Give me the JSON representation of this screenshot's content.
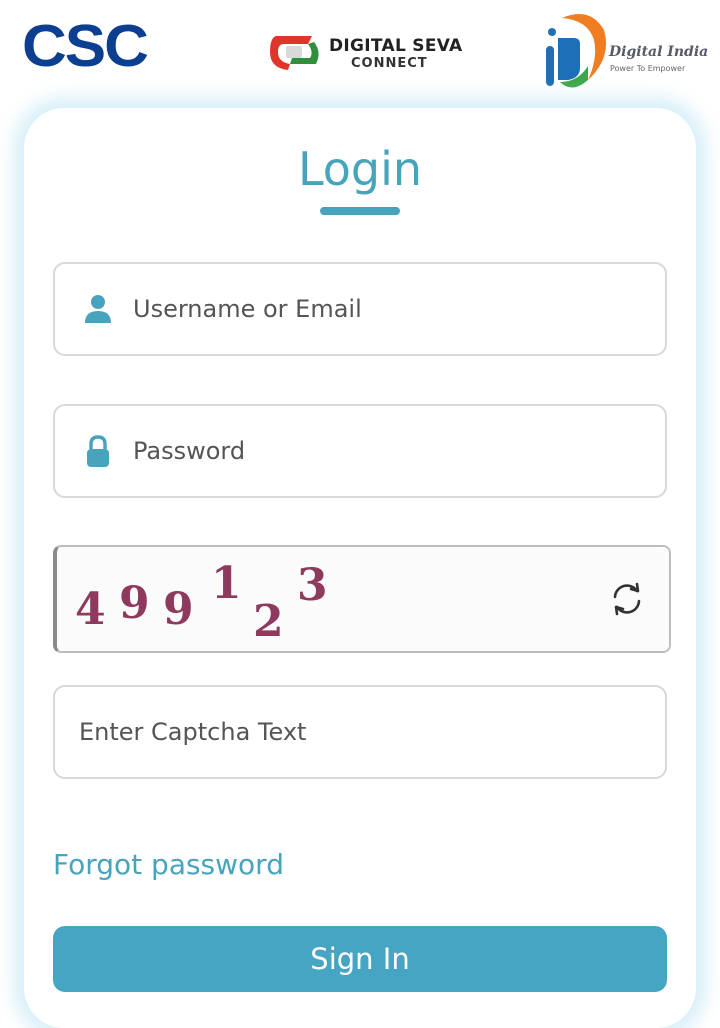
{
  "header": {
    "logos": {
      "csc": {
        "text": "CSC",
        "color": "#0c3f8f"
      },
      "digital_seva": {
        "line1": "DIGITAL SEVA",
        "line2": "CONNECT"
      },
      "digital_india": {
        "name": "Digital India",
        "tagline": "Power To Empower"
      }
    }
  },
  "login": {
    "title": "Login",
    "accent_color": "#48a4bd",
    "username": {
      "placeholder": "Username or Email",
      "icon": "user-icon"
    },
    "password": {
      "placeholder": "Password",
      "icon": "lock-icon"
    },
    "captcha": {
      "digits": [
        "4",
        "9",
        "9",
        "1",
        "2",
        "3"
      ],
      "refresh_icon": "refresh-icon",
      "input_placeholder": "Enter Captcha Text"
    },
    "forgot_password": "Forgot password",
    "sign_in": "Sign In"
  }
}
